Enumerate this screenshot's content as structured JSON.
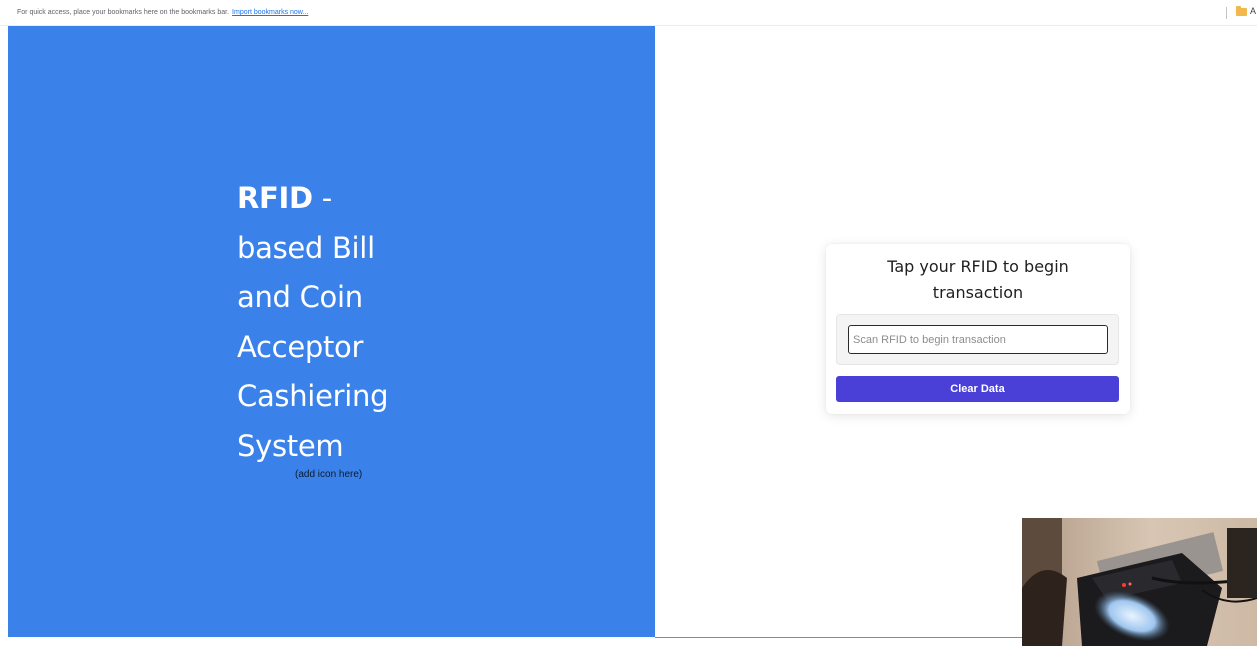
{
  "bookmarks_bar": {
    "message": "For quick access, place your bookmarks here on the bookmarks bar.",
    "import_link": "Import bookmarks now...",
    "folder_label": "A",
    "folder_icon": "folder-icon"
  },
  "hero": {
    "title_strong": "RFID",
    "title_dash": " -",
    "title_lines": [
      "based Bill",
      "and Coin",
      "Acceptor",
      "Cashiering",
      "System"
    ],
    "icon_placeholder": "(add icon here)",
    "background_color": "#3a82ea"
  },
  "card": {
    "heading_line1": "Tap your RFID to begin",
    "heading_line2": "transaction",
    "input_value": "",
    "input_placeholder": "Scan RFID to begin transaction",
    "clear_button_label": "Clear Data",
    "button_color": "#4a40d8"
  },
  "webcam": {
    "icon": "webcam-feed"
  }
}
